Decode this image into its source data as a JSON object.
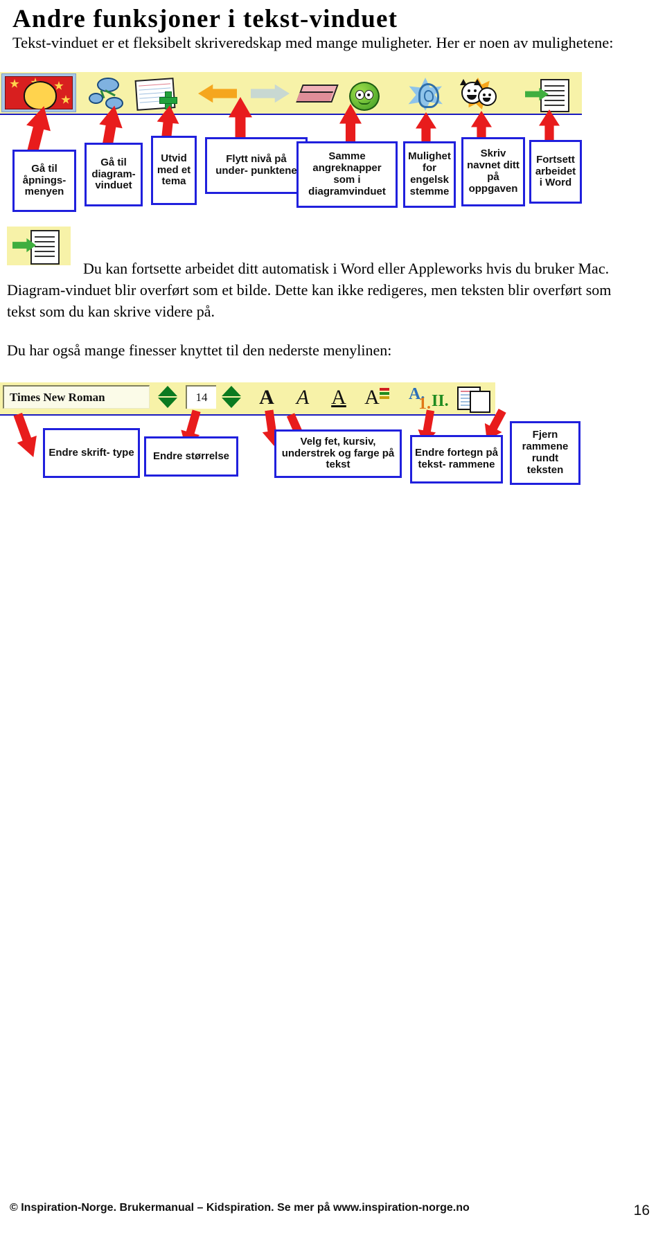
{
  "document": {
    "title": "Andre funksjoner i tekst-vinduet",
    "intro": "Tekst-vinduet er et fleksibelt skriveredskap med mange muligheter. Her er noen av mulighetene:",
    "paragraph_1": "Du kan fortsette arbeidet ditt automatisk i Word eller Appleworks hvis du bruker Mac. Diagram-vinduet blir overført som et bilde. Dette kan ikke redigeres, men teksten blir overført som tekst som du kan skrive videre på.",
    "paragraph_2": "Du har også mange finesser knyttet til den nederste menylinen:"
  },
  "top_toolbar": {
    "icons": [
      {
        "name": "clipart-face-icon",
        "tooltip": "Gå til åpningsmenyen"
      },
      {
        "name": "diagram-view-icon",
        "tooltip": "Gå til diagramvinduet"
      },
      {
        "name": "add-card-icon",
        "tooltip": "Utvid med et tema"
      },
      {
        "name": "arrow-left-orange-icon",
        "tooltip": "Flytt nivå på underpunktene"
      },
      {
        "name": "arrow-right-grey-icon",
        "tooltip": "Flytt nivå på underpunktene"
      },
      {
        "name": "eraser-icon",
        "tooltip": "Samme angreknapper som i diagramvinduet"
      },
      {
        "name": "green-face-icon",
        "tooltip": "Samme angreknapper som i diagramvinduet"
      },
      {
        "name": "listen-ear-icon",
        "tooltip": "Mulighet for engelsk stemme"
      },
      {
        "name": "two-kids-icon",
        "tooltip": "Skriv navnet ditt på oppgaven"
      },
      {
        "name": "export-to-word-icon",
        "tooltip": "Fortsett arbeidet i Word"
      }
    ],
    "callouts": [
      {
        "text": "Gå til åpnings- menyen"
      },
      {
        "text": "Gå til diagram- vinduet"
      },
      {
        "text": "Utvid med et tema"
      },
      {
        "text": "Flytt nivå på under- punktene"
      },
      {
        "text": "Samme angreknapper som i diagramvinduet"
      },
      {
        "text": "Mulighet for engelsk stemme"
      },
      {
        "text": "Skriv navnet ditt på oppgaven"
      },
      {
        "text": "Fortsett arbeidet i Word"
      }
    ]
  },
  "bottom_toolbar": {
    "font_name": "Times New Roman",
    "font_size": "14",
    "glyphs": {
      "bold": "A",
      "italic": "A",
      "underline": "A",
      "color": "A",
      "numbering_a": "A.",
      "numbering_1": "1.",
      "numbering_ii": "II."
    },
    "callouts": [
      {
        "text": "Endre skrift- type"
      },
      {
        "text": "Endre størrelse"
      },
      {
        "text": "Velg fet, kursiv, understrek og farge på tekst"
      },
      {
        "text": "Endre fortegn på tekst- rammene"
      },
      {
        "text": "Fjern rammene rundt teksten"
      }
    ]
  },
  "footer": {
    "text": "© Inspiration-Norge. Brukermanual – Kidspiration. Se mer på www.inspiration-norge.no",
    "page_number": "16"
  },
  "colors": {
    "toolbar_background": "#f7f2a8",
    "callout_border": "#2020dd",
    "arrow": "#e81c1c",
    "toolbar_rule": "#1b1bbf"
  }
}
